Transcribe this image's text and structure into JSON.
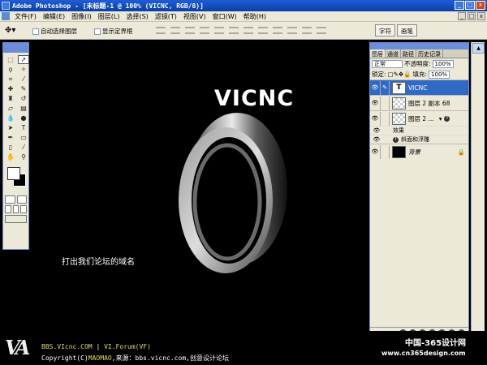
{
  "window": {
    "title": "Adobe Photoshop - [未标题-1 @ 100% (VICNC, RGB/8)]",
    "controls": [
      "_",
      "□",
      "x"
    ]
  },
  "menubar": {
    "items": [
      "文件(F)",
      "编辑(E)",
      "图像(I)",
      "图层(L)",
      "选择(S)",
      "滤镜(T)",
      "视图(V)",
      "窗口(W)",
      "帮助(H)"
    ],
    "doc_controls": [
      "_",
      "□",
      "x"
    ]
  },
  "options_bar": {
    "tool_icon": "move-tool-icon",
    "auto_select_label": "自动选择图层",
    "show_bounds_label": "显示定界框",
    "palette_well_tabs": [
      "字符",
      "画笔"
    ]
  },
  "toolbox": {
    "tools": [
      "marquee",
      "move",
      "lasso",
      "magic-wand",
      "crop",
      "slice",
      "healing",
      "brush",
      "stamp",
      "history-brush",
      "eraser",
      "gradient",
      "blur",
      "dodge",
      "path-select",
      "type",
      "pen",
      "shape",
      "notes",
      "eyedropper",
      "hand",
      "zoom"
    ],
    "foreground_color": "#ffffff",
    "background_color": "#000000"
  },
  "canvas": {
    "headline": "VICNC",
    "caption": "打出我们论坛的域名"
  },
  "layers_palette": {
    "tabs": [
      "图层",
      "通道",
      "路径",
      "历史记录"
    ],
    "blend_mode": "正常",
    "opacity_label": "不透明度:",
    "opacity_value": "100%",
    "lock_label": "锁定:",
    "fill_label": "填充:",
    "fill_value": "100%",
    "layers": [
      {
        "name": "VICNC",
        "thumb": "T",
        "selected": true
      },
      {
        "name": "图层 2 副本 68",
        "thumb": "",
        "selected": false
      },
      {
        "name": "图层 2 ...",
        "thumb": "",
        "selected": false
      }
    ],
    "effects_label": "效果",
    "effect_item": "斜面和浮雕",
    "background_layer": "背景"
  },
  "footer": {
    "logo": "VA",
    "site": "BBS.VIcnc.COM",
    "separator": "|",
    "forum": "VI.Forum(VF)",
    "copyright_prefix": "Copyright(C)",
    "author": "MAOMAO",
    "source_text": ",来源：bbs.vicnc.com,创意设计论坛"
  },
  "watermark": {
    "cn": "中国-365设计网",
    "url": "www.cn365design.com"
  }
}
